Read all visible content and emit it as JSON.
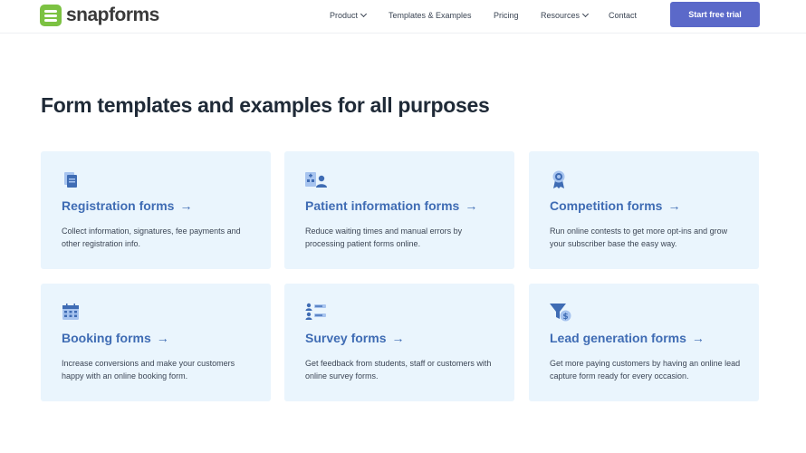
{
  "brand": {
    "name": "snapforms",
    "accent": "#7cc242",
    "primary": "#5b69c9",
    "title_color": "#3f6cb4"
  },
  "nav": {
    "items": [
      {
        "label": "Product",
        "has_dropdown": true
      },
      {
        "label": "Templates & Examples",
        "has_dropdown": false
      },
      {
        "label": "Pricing",
        "has_dropdown": false
      },
      {
        "label": "Resources",
        "has_dropdown": true
      },
      {
        "label": "Contact",
        "has_dropdown": false
      }
    ],
    "cta_label": "Start free trial"
  },
  "page": {
    "heading": "Form templates and examples for all purposes"
  },
  "cards": [
    {
      "title": "Registration forms",
      "arrow": "→",
      "description": "Collect information, signatures, fee payments and other registration info.",
      "icon": "document-copy-icon"
    },
    {
      "title": "Patient information forms",
      "arrow": "→",
      "description": "Reduce waiting times and manual errors by processing patient forms online.",
      "icon": "hospital-patient-icon"
    },
    {
      "title": "Competition forms",
      "arrow": "→",
      "description": "Run online contests to get more opt-ins and grow your subscriber base the easy way.",
      "icon": "award-ribbon-icon"
    },
    {
      "title": "Booking forms",
      "arrow": "→",
      "description": "Increase conversions and make your customers happy with an online booking form.",
      "icon": "calendar-icon"
    },
    {
      "title": "Survey forms",
      "arrow": "→",
      "description": "Get feedback from students, staff or customers with online survey forms.",
      "icon": "survey-list-icon"
    },
    {
      "title": "Lead generation forms",
      "arrow": "→",
      "description": "Get more paying customers by having an online lead capture form ready for every occasion.",
      "icon": "funnel-dollar-icon"
    }
  ]
}
